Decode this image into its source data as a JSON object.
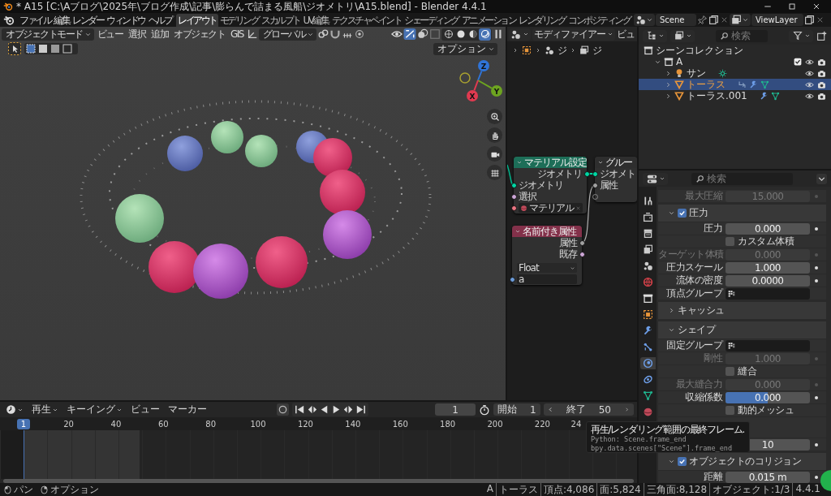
{
  "window": {
    "title": "* A15 [C:\\Aブログ\\2025年\\ブログ作成\\記事\\膨らんで詰まる風船\\ジオメトリ\\A15.blend] - Blender 4.4.1"
  },
  "menu": [
    "ファイル",
    "編集",
    "レンダー",
    "ウィンドウ",
    "ヘルプ"
  ],
  "workspaces": [
    {
      "label": "レイアウト",
      "selected": true
    },
    {
      "label": "モデリング",
      "selected": false
    },
    {
      "label": "スカルプト",
      "selected": false
    },
    {
      "label": "UV編集",
      "selected": false
    },
    {
      "label": "テクスチャペイント",
      "selected": false
    },
    {
      "label": "シェーディング",
      "selected": false
    },
    {
      "label": "アニメーション",
      "selected": false
    },
    {
      "label": "レンダリング",
      "selected": false
    },
    {
      "label": "コンポジティング",
      "selected": false
    }
  ],
  "scene": "Scene",
  "view_layer": "ViewLayer",
  "viewport": {
    "mode": "オブジェクトモード",
    "menus": [
      "ビュー",
      "選択",
      "追加",
      "オブジェクト",
      "GIS"
    ],
    "orientation": "グローバル",
    "shading": [
      {
        "kind": "wireframe",
        "selected": false
      },
      {
        "kind": "solid",
        "selected": false
      },
      {
        "kind": "material",
        "selected": false
      },
      {
        "kind": "rendered",
        "selected": true
      }
    ],
    "options": "オプション",
    "axes": [
      {
        "label": "Z",
        "color": "#2f74d8"
      },
      {
        "label": "Y",
        "color": "#6da420"
      },
      {
        "label": "X",
        "color": "#e03a50"
      }
    ]
  },
  "node_editor": {
    "editor": "モディファイアー",
    "view_menu": "ビュ",
    "breadcrumbs": [
      "ジ",
      "ジ"
    ],
    "nodes": [
      {
        "title": "マテリアル設定",
        "color": "#1d6e58",
        "rows": [
          {
            "kind": "output",
            "label": "ジオメトリ",
            "color": "#00d6a3"
          },
          {
            "kind": "input",
            "label": "ジオメトリ",
            "color": "#00d6a3"
          },
          {
            "kind": "input",
            "label": "選択",
            "color": "#cca6d6"
          },
          {
            "kind": "material",
            "label": "マテリアル",
            "color": "#eb7582"
          }
        ]
      },
      {
        "title": "グルー",
        "color": "#2e2e2e",
        "rows": [
          {
            "kind": "input",
            "label": "ジオメト",
            "color": "#00d6a3"
          },
          {
            "kind": "input",
            "label": "属性",
            "color": "#a1a1a1"
          },
          {
            "kind": "empty"
          }
        ]
      },
      {
        "title": "名前付き属性",
        "color": "#83314a",
        "rows": [
          {
            "kind": "output",
            "label": "属性",
            "color": "#a1a1a1"
          },
          {
            "kind": "output",
            "label": "既存",
            "color": "#cca6d6"
          },
          {
            "kind": "dropdown",
            "label": "Float"
          },
          {
            "kind": "field",
            "label": "a",
            "color": "#6c9bd8"
          }
        ]
      }
    ]
  },
  "timeline": {
    "menus": [
      "再生",
      "キーイング",
      "ビュー",
      "マーカー"
    ],
    "frame": "1",
    "start_label": "開始",
    "start": "1",
    "end_label": "終了",
    "end": "50",
    "current": "1",
    "ticks": [
      "20",
      "40",
      "60",
      "80",
      "100",
      "120",
      "140",
      "160",
      "180",
      "200",
      "220",
      "24"
    ]
  },
  "tooltip": {
    "title": "再生/レンダリング範囲の最終フレーム.",
    "lines": [
      "Python: Scene.frame_end",
      "bpy.data.scenes[\"Scene\"].frame_end"
    ]
  },
  "outliner": {
    "placeholder": "検索",
    "tree": [
      {
        "label": "シーンコレクション",
        "kind": "scene",
        "selected": false,
        "children": [
          {
            "label": "A",
            "kind": "collection",
            "selected": false,
            "expanded": true,
            "checked": true,
            "children": [
              {
                "label": "サン",
                "kind": "light",
                "selected": false,
                "expanded": false,
                "physics": false,
                "modifiers": false
              },
              {
                "label": "トーラス",
                "kind": "mesh",
                "selected": true,
                "expanded": false,
                "physics": true,
                "modifiers": true
              },
              {
                "label": "トーラス.001",
                "kind": "mesh",
                "selected": false,
                "expanded": false,
                "physics": false,
                "modifiers": true
              }
            ]
          }
        ]
      }
    ]
  },
  "properties": {
    "placeholder": "検索",
    "tabs": [
      {
        "kind": "tool",
        "selected": false
      },
      {
        "kind": "render",
        "selected": false
      },
      {
        "kind": "output",
        "selected": false
      },
      {
        "kind": "view_layer",
        "selected": false
      },
      {
        "kind": "scene",
        "selected": false
      },
      {
        "kind": "world",
        "selected": false
      },
      {
        "kind": "collection",
        "selected": false
      },
      {
        "kind": "object",
        "selected": false
      },
      {
        "kind": "modifier",
        "selected": false
      },
      {
        "kind": "particles",
        "selected": false
      },
      {
        "kind": "physics",
        "selected": true
      },
      {
        "kind": "constraint",
        "selected": false
      },
      {
        "kind": "data",
        "selected": false
      },
      {
        "kind": "material",
        "selected": false
      }
    ],
    "rows": [
      {
        "kind": "number",
        "label": "最大圧縮",
        "value": "15.000",
        "disabled": true
      },
      {
        "kind": "panel",
        "label": "圧力",
        "expanded": true,
        "checked": true
      },
      {
        "kind": "number",
        "label": "圧力",
        "value": "0.000",
        "disabled": false
      },
      {
        "kind": "checkbox",
        "label": "カスタム体積",
        "checked": false
      },
      {
        "kind": "number",
        "label": "ターゲット体積",
        "value": "0.000",
        "disabled": true
      },
      {
        "kind": "number",
        "label": "圧力スケール",
        "value": "1.000",
        "disabled": false
      },
      {
        "kind": "number",
        "label": "流体の密度",
        "value": "0.0000",
        "disabled": false
      },
      {
        "kind": "group",
        "label": "頂点グループ"
      },
      {
        "kind": "panel",
        "label": "キャッシュ",
        "expanded": false
      },
      {
        "kind": "panel",
        "label": "シェイプ",
        "expanded": true
      },
      {
        "kind": "group",
        "label": "固定グループ"
      },
      {
        "kind": "number",
        "label": "剛性",
        "value": "1.000",
        "disabled": true
      },
      {
        "kind": "checkbox",
        "label": "縫合",
        "checked": false
      },
      {
        "kind": "number",
        "label": "最大縫合力",
        "value": "0.000",
        "disabled": true
      },
      {
        "kind": "slider",
        "label": "収縮係数",
        "value": "0.000",
        "level": 0.5
      },
      {
        "kind": "checkbox",
        "label": "動的メッシュ",
        "checked": false
      },
      {
        "kind": "spacer"
      },
      {
        "kind": "number",
        "value": "10",
        "disabled": false
      },
      {
        "kind": "panel",
        "label": "オブジェクトのコリジョン",
        "expanded": true,
        "checked": true
      },
      {
        "kind": "number",
        "label": "距離",
        "value": "0.015 m",
        "disabled": false
      }
    ]
  },
  "status": {
    "hints": [
      {
        "kind": "mouse_left",
        "label": "パン"
      },
      {
        "kind": "mouse_right",
        "label": "オプション"
      }
    ],
    "stats": [
      "A",
      "トーラス",
      "頂点:4,086",
      "面:5,824",
      "三角面:8,128",
      "オブジェクト:1/3",
      "4.4.1"
    ]
  }
}
